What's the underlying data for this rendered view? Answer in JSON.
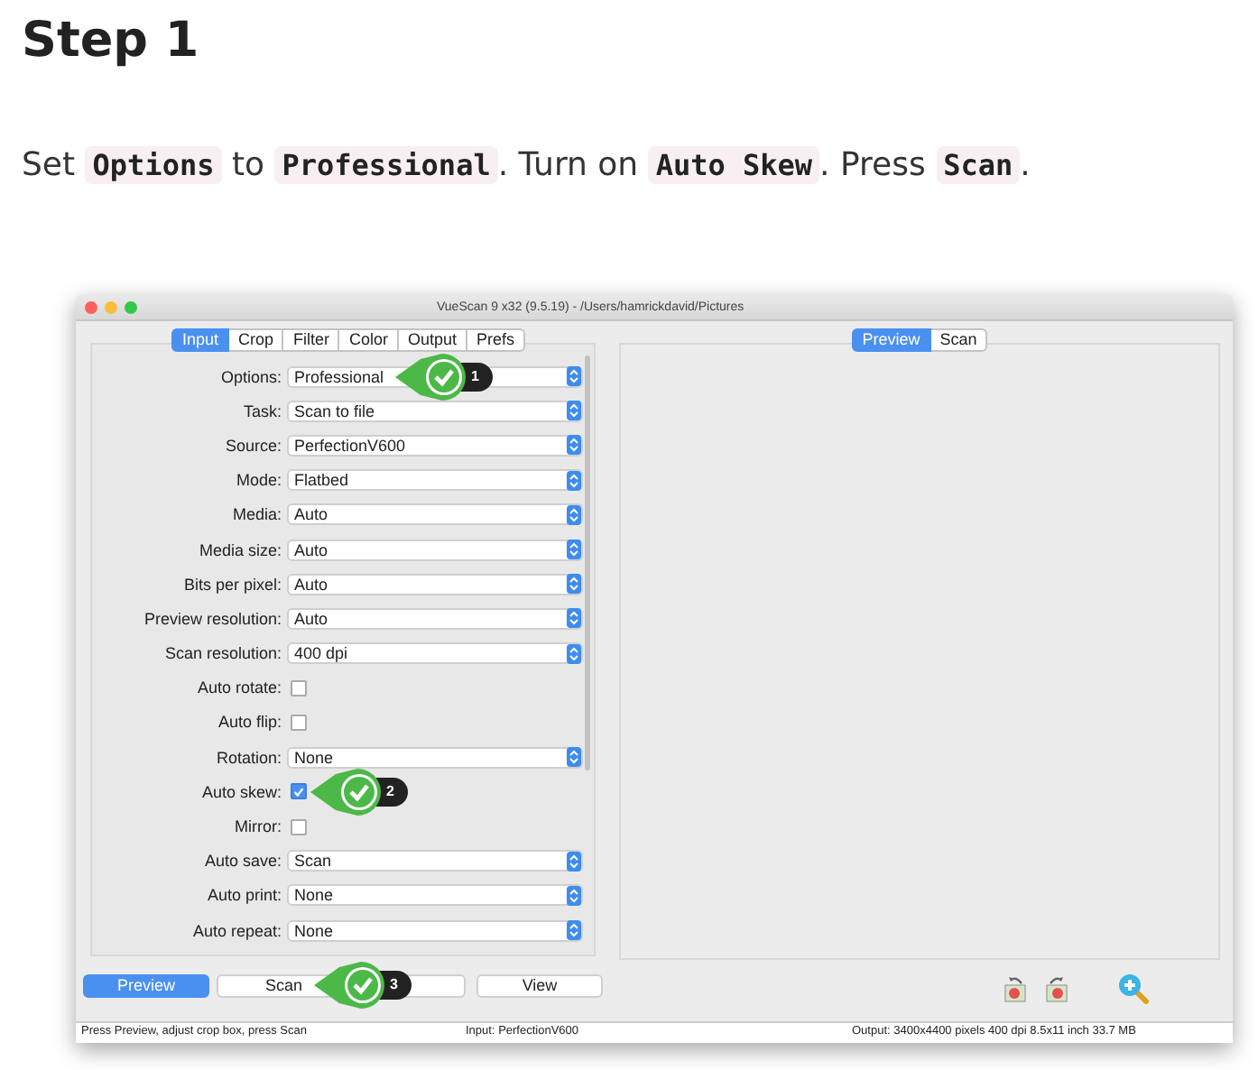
{
  "heading": "Step 1",
  "instruction": [
    {
      "kind": "text",
      "text": "Set "
    },
    {
      "kind": "code",
      "text": "Options"
    },
    {
      "kind": "text",
      "text": " to "
    },
    {
      "kind": "code",
      "text": "Professional"
    },
    {
      "kind": "text",
      "text": ". Turn on "
    },
    {
      "kind": "code",
      "text": "Auto Skew"
    },
    {
      "kind": "text",
      "text": ". Press "
    },
    {
      "kind": "code",
      "text": "Scan"
    },
    {
      "kind": "text",
      "text": "."
    }
  ],
  "window": {
    "title": "VueScan 9 x32 (9.5.19) - /Users/hamrickdavid/Pictures",
    "tabs": [
      {
        "label": "Input",
        "selected": true
      },
      {
        "label": "Crop",
        "selected": false
      },
      {
        "label": "Filter",
        "selected": false
      },
      {
        "label": "Color",
        "selected": false
      },
      {
        "label": "Output",
        "selected": false
      },
      {
        "label": "Prefs",
        "selected": false
      }
    ],
    "settings": [
      {
        "kind": "select",
        "label": "Options:",
        "value": "Professional",
        "callout": "1"
      },
      {
        "kind": "select",
        "label": "Task:",
        "value": "Scan to file"
      },
      {
        "kind": "select",
        "label": "Source:",
        "value": "PerfectionV600"
      },
      {
        "kind": "select",
        "label": "Mode:",
        "value": "Flatbed"
      },
      {
        "kind": "select",
        "label": "Media:",
        "value": "Auto"
      },
      {
        "kind": "select",
        "label": "Media size:",
        "value": "Auto"
      },
      {
        "kind": "select",
        "label": "Bits per pixel:",
        "value": "Auto"
      },
      {
        "kind": "select",
        "label": "Preview resolution:",
        "value": "Auto"
      },
      {
        "kind": "select",
        "label": "Scan resolution:",
        "value": "400 dpi"
      },
      {
        "kind": "checkbox",
        "label": "Auto rotate:",
        "checked": false
      },
      {
        "kind": "checkbox",
        "label": "Auto flip:",
        "checked": false
      },
      {
        "kind": "select",
        "label": "Rotation:",
        "value": "None"
      },
      {
        "kind": "checkbox",
        "label": "Auto skew:",
        "checked": true,
        "callout": "2"
      },
      {
        "kind": "checkbox",
        "label": "Mirror:",
        "checked": false
      },
      {
        "kind": "select",
        "label": "Auto save:",
        "value": "Scan"
      },
      {
        "kind": "select",
        "label": "Auto print:",
        "value": "None"
      },
      {
        "kind": "select",
        "label": "Auto repeat:",
        "value": "None"
      }
    ],
    "view_tabs": [
      {
        "label": "Preview",
        "selected": true
      },
      {
        "label": "Scan",
        "selected": false
      }
    ],
    "buttons": [
      {
        "label": "Preview",
        "primary": true
      },
      {
        "label": "Scan",
        "primary": false,
        "callout": "3"
      },
      {
        "label": "View",
        "primary": false
      }
    ],
    "status_bar": [
      "Press Preview, adjust crop box, press Scan",
      "Input: PerfectionV600",
      "Output: 3400x4400 pixels 400 dpi 8.5x11 inch 33.7 MB"
    ]
  }
}
